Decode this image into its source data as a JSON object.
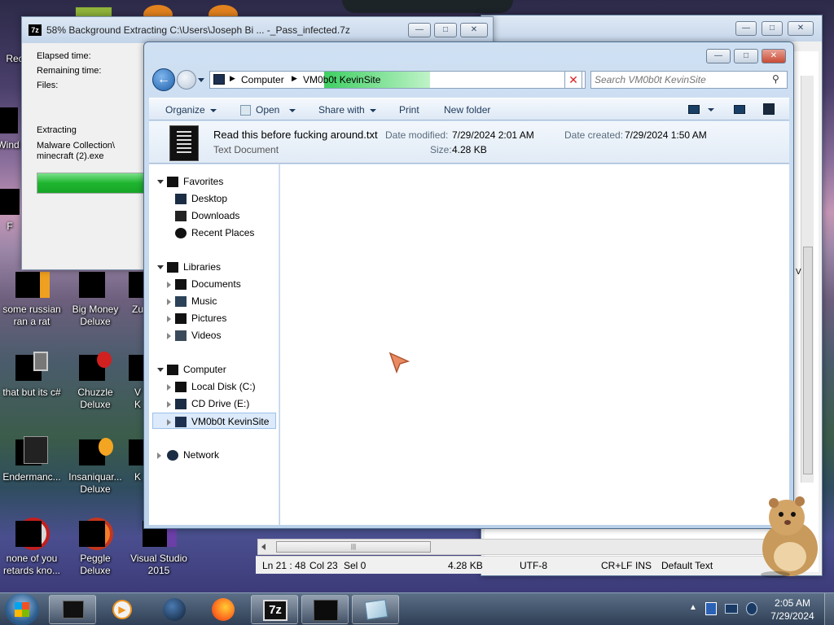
{
  "desktop": {
    "icons": [
      {
        "label_line1": "Rec",
        "label_line2": ""
      },
      {
        "label_line1": "Wind",
        "label_line2": ""
      },
      {
        "label_line1": "F",
        "label_line2": ""
      },
      {
        "label_line1": "some russian",
        "label_line2": "ran a rat"
      },
      {
        "label_line1": "Big Money",
        "label_line2": "Deluxe"
      },
      {
        "label_line1": "Zu",
        "label_line2": ""
      },
      {
        "label_line1": "that but its c#",
        "label_line2": ""
      },
      {
        "label_line1": "Chuzzle",
        "label_line2": "Deluxe"
      },
      {
        "label_line1": "V",
        "label_line2": "K"
      },
      {
        "label_line1": "Endermanc...",
        "label_line2": ""
      },
      {
        "label_line1": "Insaniquar...",
        "label_line2": "Deluxe"
      },
      {
        "label_line1": "K",
        "label_line2": ""
      },
      {
        "label_line1": "none of you",
        "label_line2": "retards kno..."
      },
      {
        "label_line1": "Peggle Deluxe",
        "label_line2": ""
      },
      {
        "label_line1": "Visual Studio",
        "label_line2": "2015"
      }
    ]
  },
  "sevenzip": {
    "app_icon": "7z",
    "title": "58% Background Extracting C:\\Users\\Joseph Bi ... -_Pass_infected.7z",
    "labels": {
      "elapsed": "Elapsed time:",
      "remaining": "Remaining time:",
      "files": "Files:"
    },
    "status": "Extracting",
    "current_file_line1": "Malware Collection\\",
    "current_file_line2": "minecraft (2).exe",
    "progress": 0.58,
    "progress_color": "#22c134"
  },
  "notepad_back": {
    "status": {
      "position": "Ln 21 : 48",
      "col": "Col 23",
      "sel": "Sel 0",
      "size": "4.28 KB",
      "encoding": "UTF-8",
      "eol": "CR+LF",
      "ins": "INS",
      "scheme": "Default Text"
    },
    "side_mark": "V"
  },
  "explorer": {
    "breadcrumb": [
      "Computer",
      "VM0b0t KevinSite"
    ],
    "search_placeholder": "Search VM0b0t KevinSite",
    "toolbar": {
      "organize": "Organize",
      "open": "Open",
      "share_with": "Share with",
      "print": "Print",
      "new_folder": "New folder"
    },
    "details": {
      "file_name": "Read this before fucking around.txt",
      "file_type": "Text Document",
      "date_modified_label": "Date modified:",
      "date_modified": "7/29/2024 2:01 AM",
      "size_label": "Size:",
      "size": "4.28 KB",
      "date_created_label": "Date created:",
      "date_created": "7/29/2024 1:50 AM"
    },
    "nav": {
      "favorites": "Favorites",
      "desktop": "Desktop",
      "downloads": "Downloads",
      "recent_places": "Recent Places",
      "libraries": "Libraries",
      "documents": "Documents",
      "music": "Music",
      "pictures": "Pictures",
      "videos": "Videos",
      "computer": "Computer",
      "local_disk": "Local Disk (C:)",
      "cd_drive": "CD Drive (E:)",
      "vm_site": "VM0b0t KevinSite",
      "network": "Network"
    },
    "accent": "#3fcf63"
  },
  "taskbar": {
    "time": "2:05 AM",
    "date": "7/29/2024",
    "apps": [
      "explorer-black",
      "media-player",
      "firefox-alt",
      "firefox",
      "7-zip",
      "terminal",
      "notepad"
    ],
    "sevenzip_label": "7z"
  }
}
